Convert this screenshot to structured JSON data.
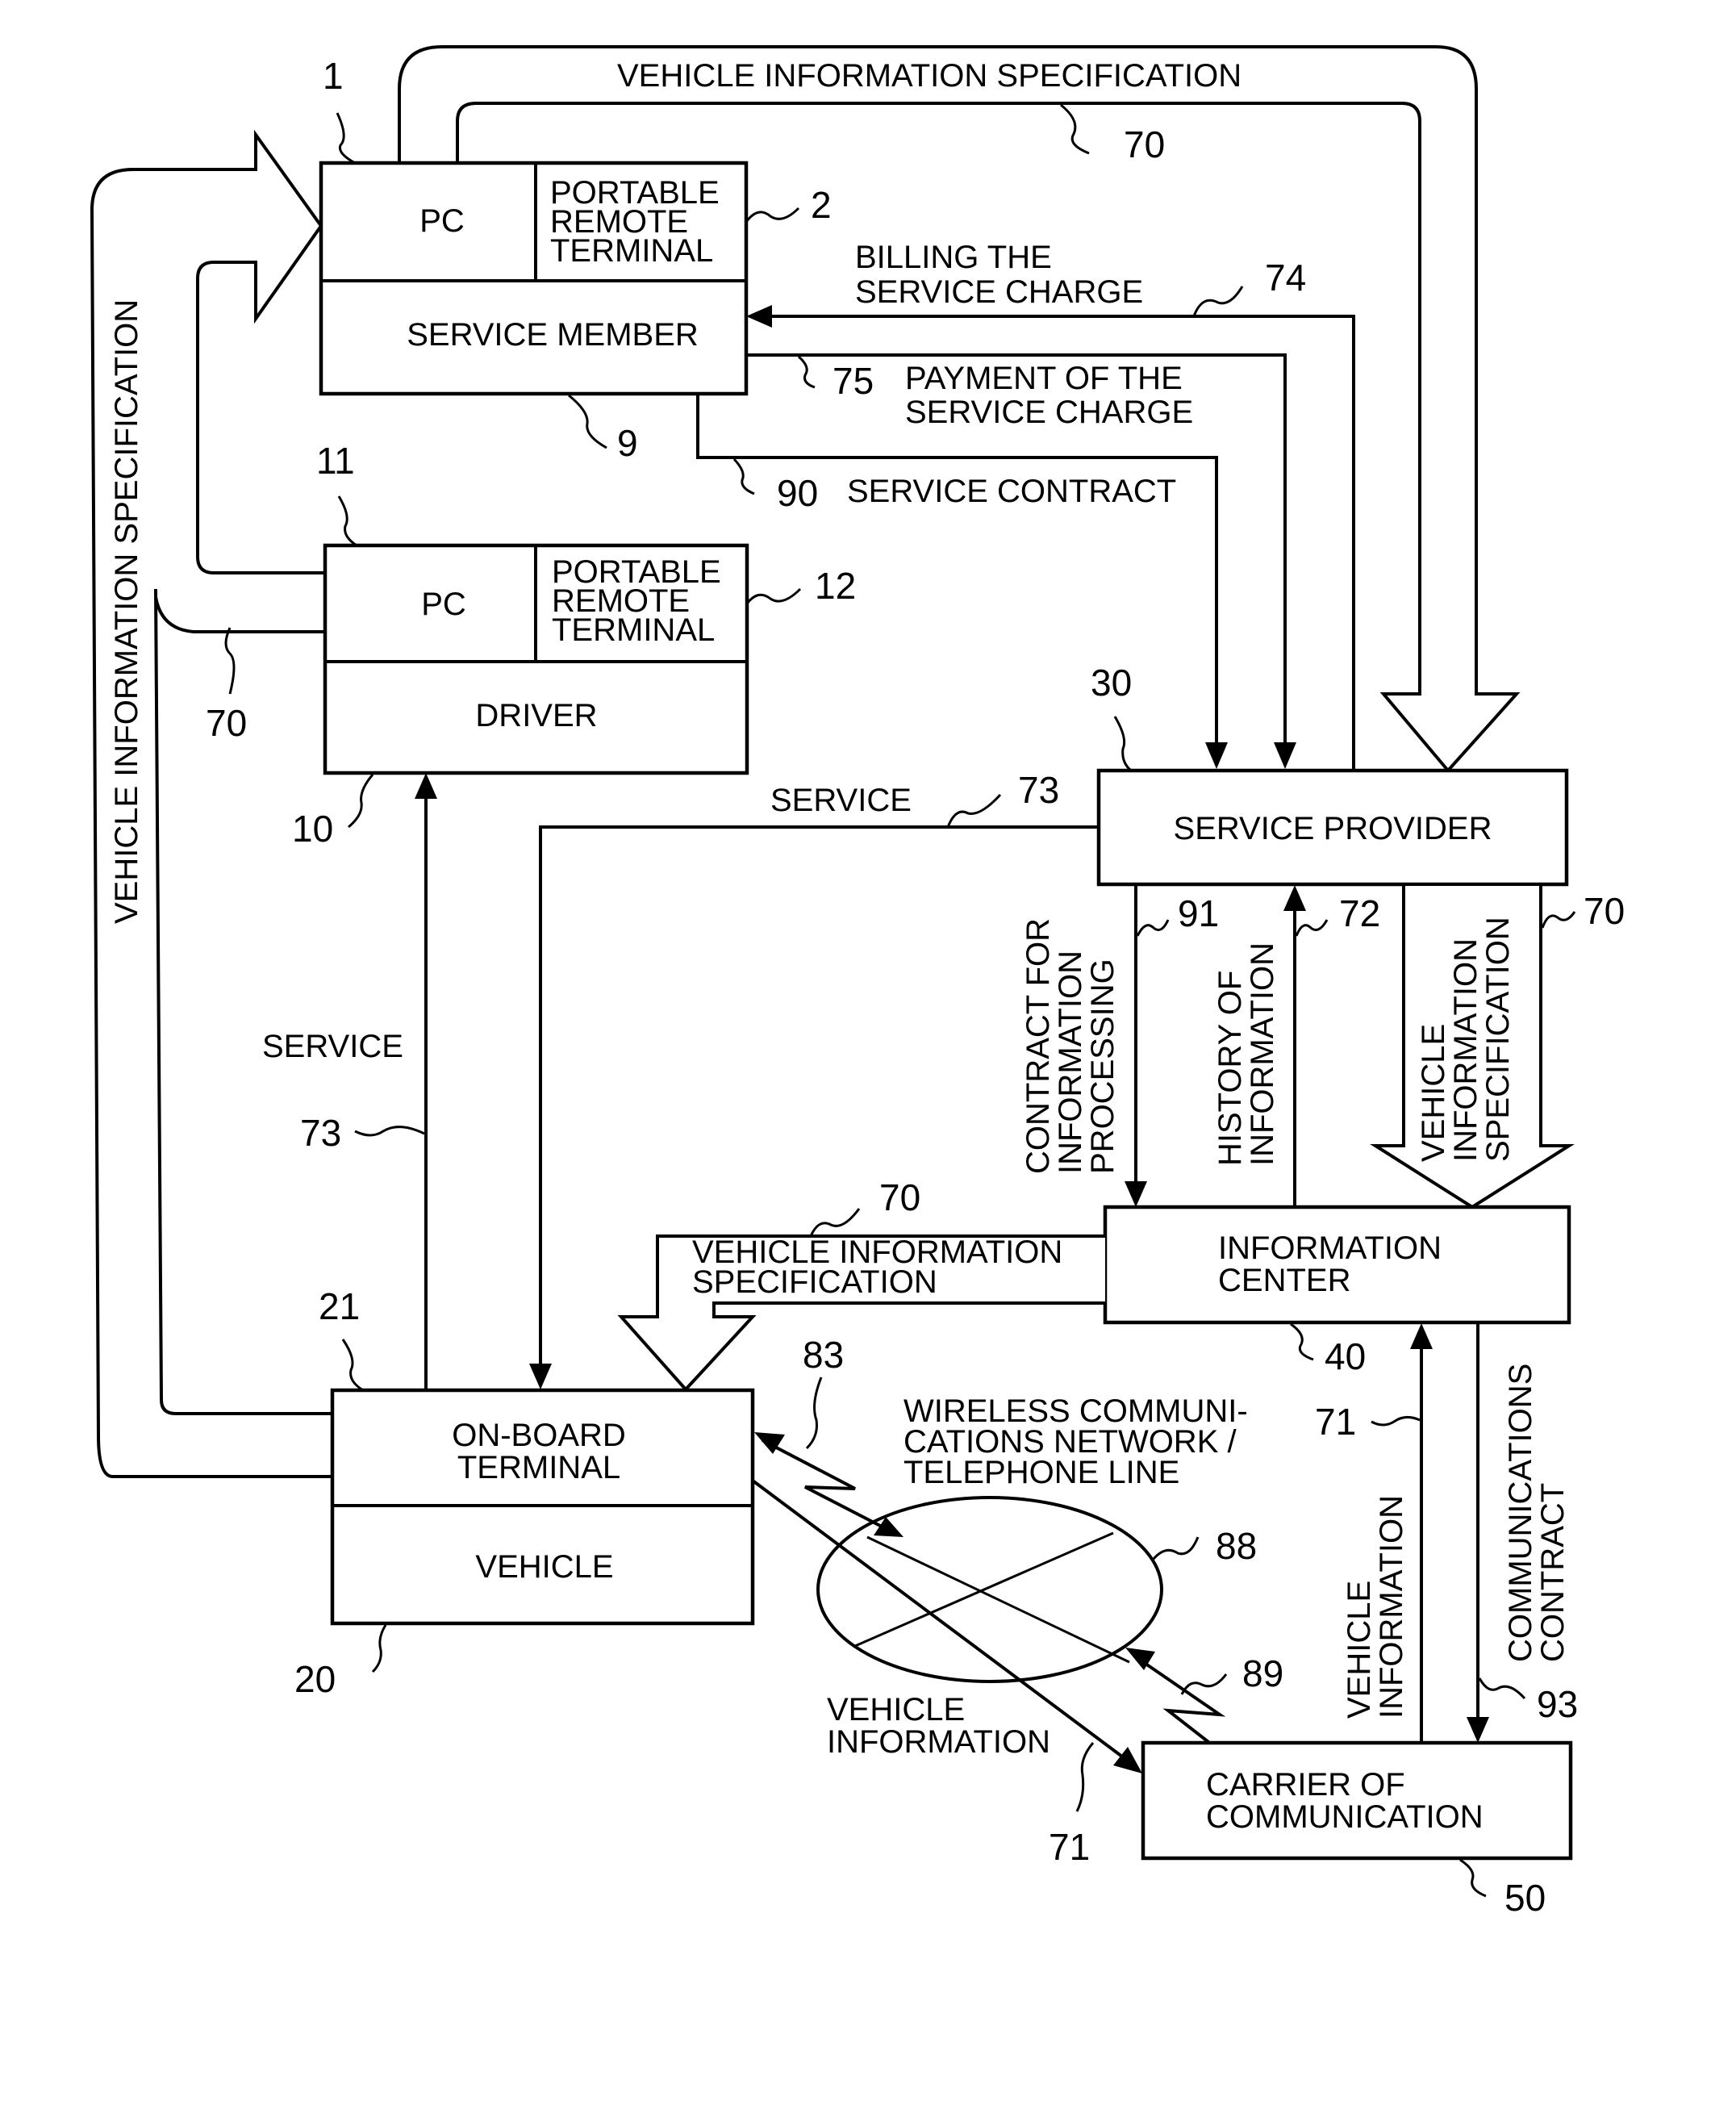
{
  "blocks": {
    "service_member_pc": "PC",
    "service_member_terminal": [
      "PORTABLE",
      "REMOTE",
      "TERMINAL"
    ],
    "service_member": "SERVICE MEMBER",
    "driver_pc": "PC",
    "driver_terminal": [
      "PORTABLE",
      "REMOTE",
      "TERMINAL"
    ],
    "driver": "DRIVER",
    "service_provider": "SERVICE PROVIDER",
    "information_center": [
      "INFORMATION",
      "CENTER"
    ],
    "onboard_terminal": [
      "ON-BOARD",
      "TERMINAL"
    ],
    "vehicle": "VEHICLE",
    "carrier": [
      "CARRIER OF",
      "COMMUNICATION"
    ],
    "network": [
      "WIRELESS COMMUNI-",
      "CATIONS NETWORK /",
      "TELEPHONE LINE"
    ]
  },
  "flows": {
    "vis_top": "VEHICLE INFORMATION SPECIFICATION",
    "vis_left": "VEHICLE INFORMATION SPECIFICATION",
    "vis_center": [
      "VEHICLE INFORMATION",
      "SPECIFICATION"
    ],
    "vis_right": [
      "VEHICLE",
      "INFORMATION",
      "SPECIFICATION"
    ],
    "billing": [
      "BILLING THE",
      "SERVICE CHARGE"
    ],
    "payment": [
      "PAYMENT OF THE",
      "SERVICE CHARGE"
    ],
    "service_contract": "SERVICE CONTRACT",
    "service_right": "SERVICE",
    "service_left": "SERVICE",
    "contract_info": [
      "CONTRACT FOR",
      "INFORMATION",
      "PROCESSING"
    ],
    "history": [
      "HISTORY OF",
      "INFORMATION"
    ],
    "vehicle_info_right": [
      "VEHICLE",
      "INFORMATION"
    ],
    "vehicle_info_bottom": [
      "VEHICLE",
      "INFORMATION"
    ],
    "comm_contract": [
      "COMMUNICATIONS",
      "CONTRACT"
    ]
  },
  "refs": {
    "r1": "1",
    "r2": "2",
    "r9": "9",
    "r10": "10",
    "r11": "11",
    "r12": "12",
    "r20": "20",
    "r21": "21",
    "r30": "30",
    "r40": "40",
    "r50": "50",
    "r70_top": "70",
    "r70_left": "70",
    "r70_right": "70",
    "r70_center": "70",
    "r71_right": "71",
    "r71_bottom": "71",
    "r72": "72",
    "r73_right": "73",
    "r73_left": "73",
    "r74": "74",
    "r75": "75",
    "r83": "83",
    "r88": "88",
    "r89": "89",
    "r90": "90",
    "r91": "91",
    "r93": "93"
  }
}
